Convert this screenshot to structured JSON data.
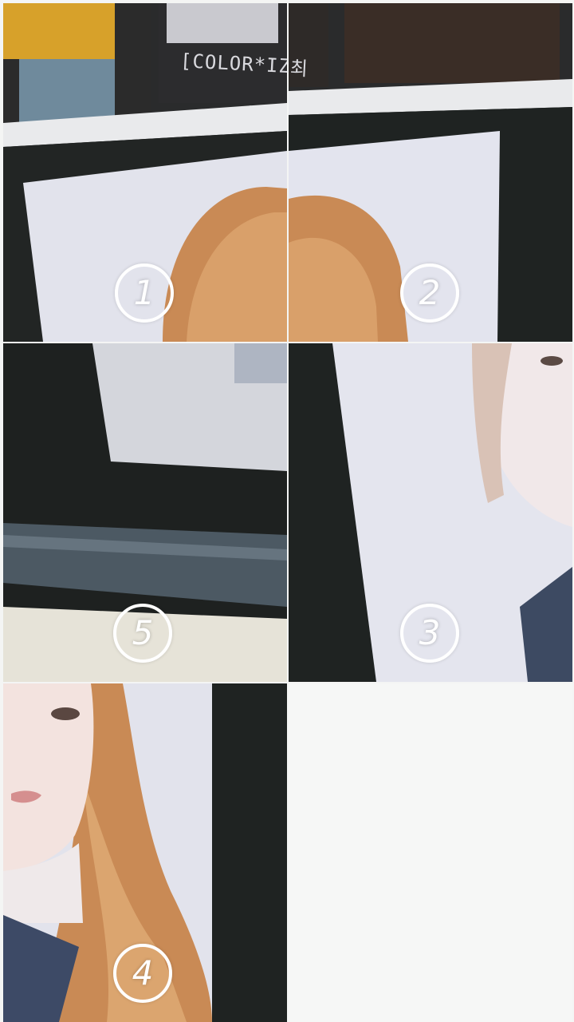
{
  "puzzle": {
    "tiles": [
      {
        "number": "1"
      },
      {
        "number": "2"
      },
      {
        "number": "5"
      },
      {
        "number": "3"
      },
      {
        "number": "4"
      }
    ],
    "screen_caption_left": "[COLOR*IZ]",
    "screen_caption_right": "최"
  },
  "colors": {
    "background": "#f4f5f4",
    "badge": "#ffffff",
    "monitor_bezel": "#1f2322",
    "hair": "#c98a55",
    "backdrop": "#dfe0ea"
  }
}
